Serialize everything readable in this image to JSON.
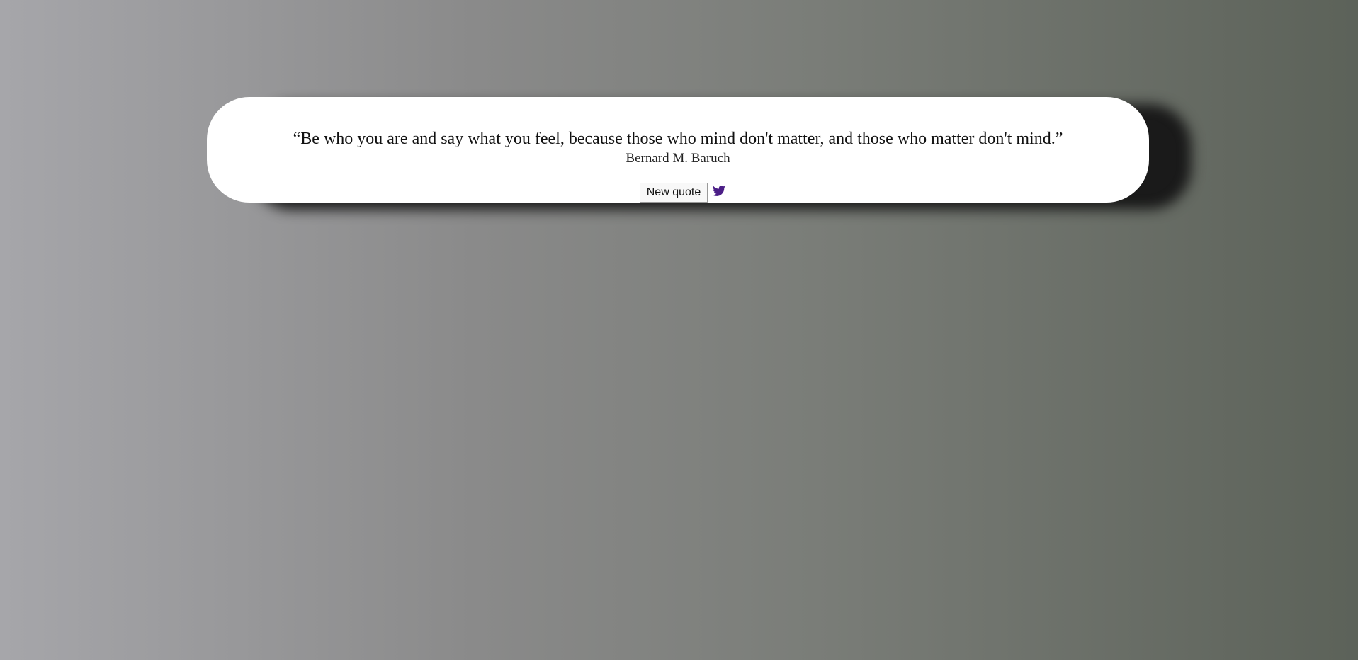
{
  "quote": {
    "text": "“Be who you are and say what you feel, because those who mind don't matter, and those who matter don't mind.”",
    "author": "Bernard M. Baruch"
  },
  "actions": {
    "new_quote_label": "New quote",
    "tweet_icon": "twitter-icon"
  },
  "colors": {
    "card": "#ffffff",
    "twitter_icon": "#4b1e87",
    "shadow": "#1a1a1a"
  }
}
